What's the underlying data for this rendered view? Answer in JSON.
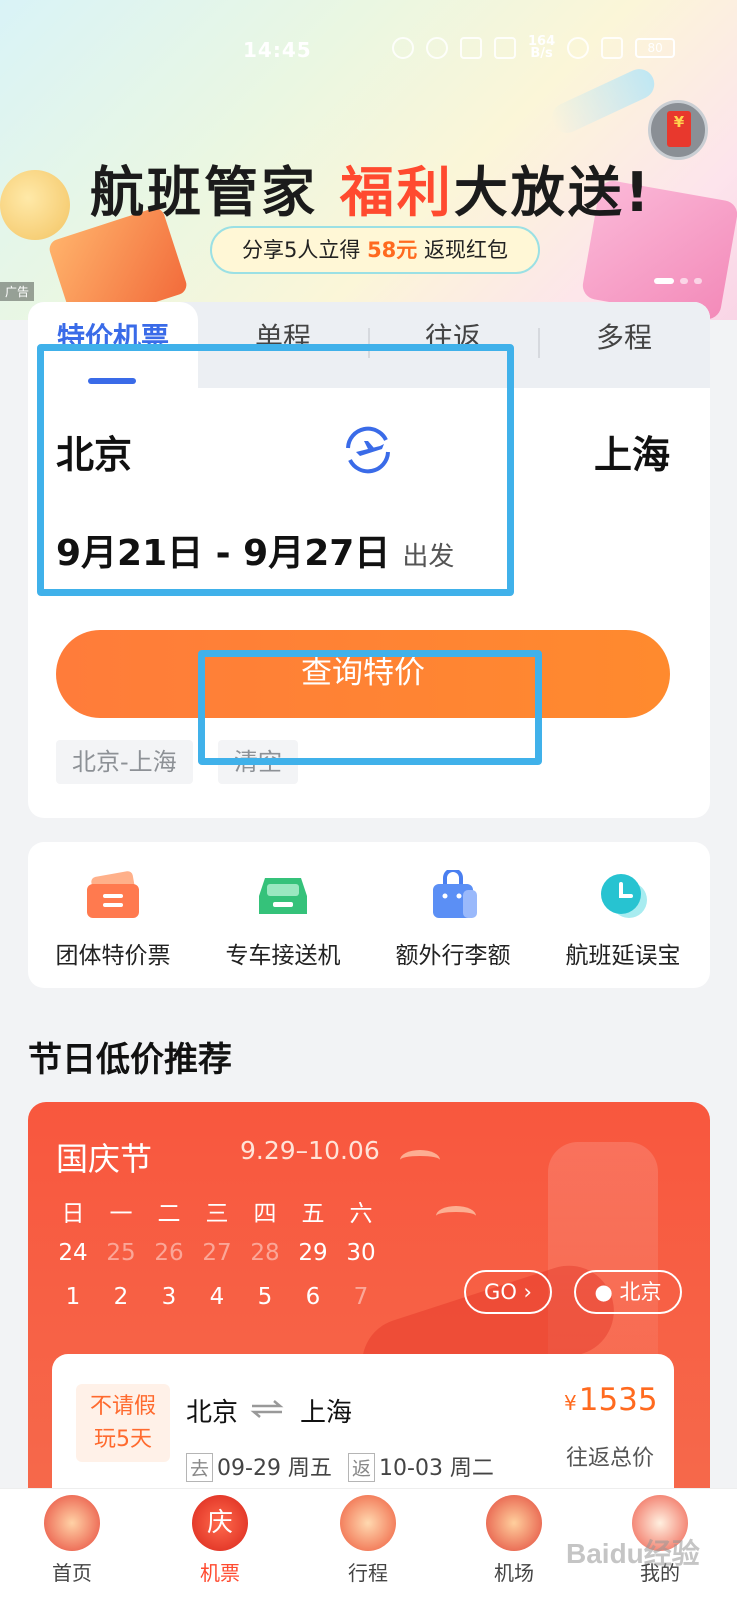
{
  "status_bar": {
    "time": "14:45",
    "network_speed_top": "164",
    "network_speed_unit": "B/s",
    "battery": "80"
  },
  "banner": {
    "headline_part1": "航班管家",
    "headline_highlight": "福利",
    "headline_part2": "大放送!",
    "sub_prefix": "分享5人立得",
    "sub_amount": "58元",
    "sub_suffix": "返现红包",
    "ad_tag": "广告"
  },
  "tabs": [
    {
      "label": "特价机票"
    },
    {
      "label": "单程"
    },
    {
      "label": "往返"
    },
    {
      "label": "多程"
    }
  ],
  "search": {
    "from_city": "北京",
    "to_city": "上海",
    "date_range": "9月21日 - 9月27日",
    "date_suffix": "出发",
    "button_label": "查询特价",
    "history": "北京-上海",
    "clear": "清空"
  },
  "services": [
    {
      "label": "团体特价票",
      "icon": "group-ticket-icon"
    },
    {
      "label": "专车接送机",
      "icon": "car-icon"
    },
    {
      "label": "额外行李额",
      "icon": "luggage-bag-icon"
    },
    {
      "label": "航班延误宝",
      "icon": "clock-icon"
    }
  ],
  "section_title": "节日低价推荐",
  "holiday": {
    "title": "国庆节",
    "range": "9.29–10.06",
    "weekdays": [
      "日",
      "一",
      "二",
      "三",
      "四",
      "五",
      "六"
    ],
    "week1": [
      "24",
      "25",
      "26",
      "27",
      "28",
      "29",
      "30"
    ],
    "week2": [
      "1",
      "2",
      "3",
      "4",
      "5",
      "6",
      "7"
    ],
    "go_label": "GO",
    "location_label": "北京",
    "route": {
      "badge_line1": "不请假",
      "badge_line2": "玩5天",
      "from": "北京",
      "to": "上海",
      "depart_tag": "去",
      "depart_date": "09-29 周五",
      "return_tag": "返",
      "return_date": "10-03 周二",
      "currency": "¥",
      "price": "1535",
      "price_note": "往返总价"
    }
  },
  "bottom_nav": [
    {
      "label": "首页"
    },
    {
      "label": "机票"
    },
    {
      "label": "行程"
    },
    {
      "label": "机场"
    },
    {
      "label": "我的"
    }
  ],
  "nav_badge": "庆",
  "watermark": "Baidu经验",
  "colors": {
    "accent": "#3a6be8",
    "orange": "#ff7c3a",
    "holiday_red": "#f8573e",
    "annotation": "#40b1ea"
  }
}
